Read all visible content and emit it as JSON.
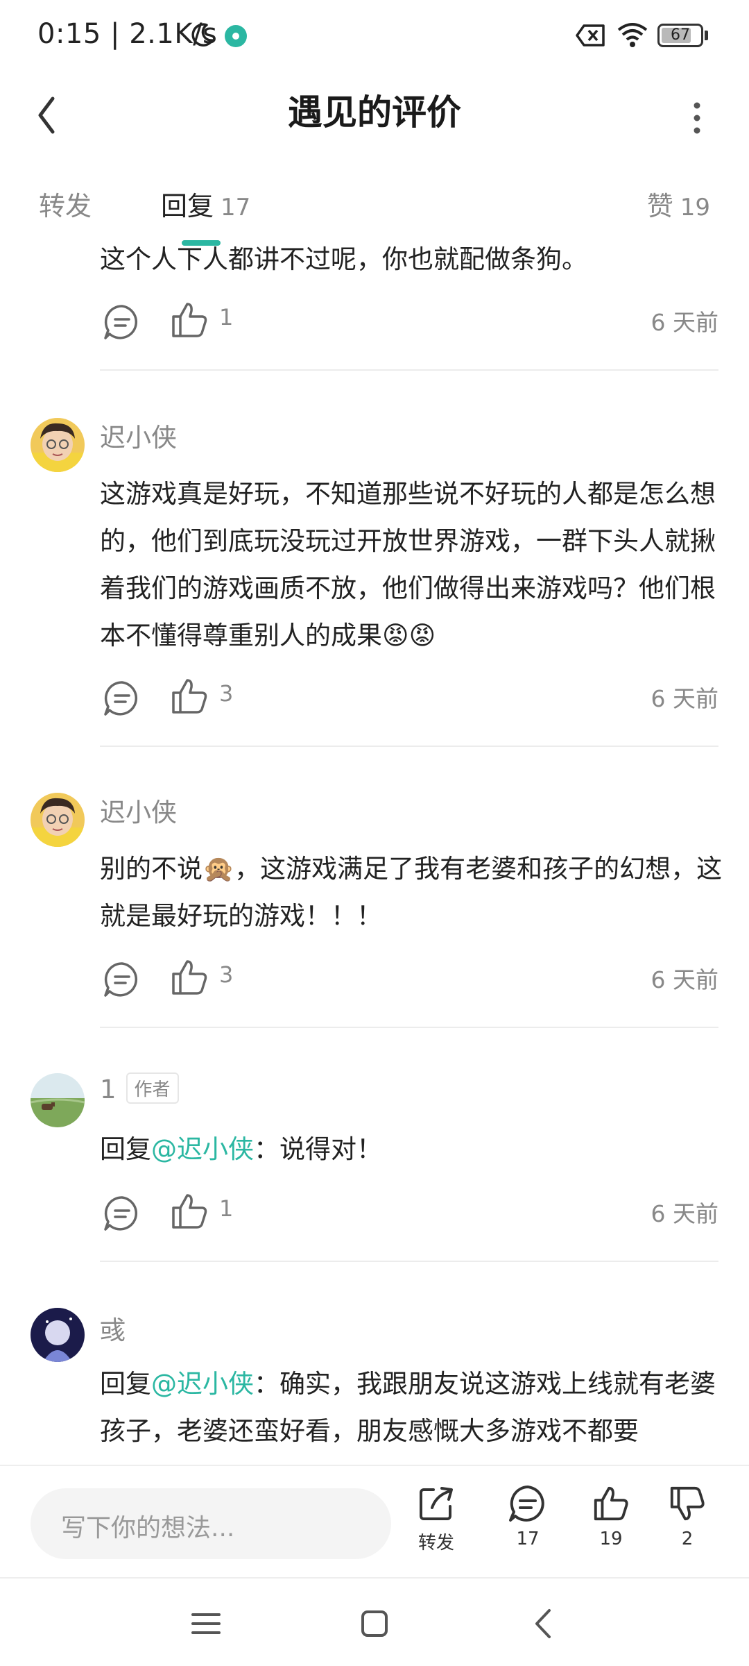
{
  "status_bar": {
    "time_speed": "0:15 | 2.1K/s",
    "battery": "67"
  },
  "header": {
    "title": "遇见的评价"
  },
  "tabs": {
    "repost_label": "转发",
    "reply_label": "回复",
    "reply_count": "17",
    "like_label": "赞",
    "like_count": "19"
  },
  "comments": [
    {
      "text": "这个人下人都讲不过呢，你也就配做条狗。",
      "likes": "1",
      "time": "6 天前"
    },
    {
      "user": "迟小侠",
      "text": "这游戏真是好玩，不知道那些说不好玩的人都是怎么想的，他们到底玩没玩过开放世界游戏，一群下头人就揪着我们的游戏画质不放，他们做得出来游戏吗？他们根本不懂得尊重别人的成果😡😡",
      "likes": "3",
      "time": "6 天前"
    },
    {
      "user": "迟小侠",
      "text": "别的不说🙊，这游戏满足了我有老婆和孩子的幻想，这就是最好玩的游戏！！！",
      "likes": "3",
      "time": "6 天前"
    },
    {
      "user": "1",
      "badge": "作者",
      "reply_prefix": "回复",
      "mention": "@迟小侠",
      "text": "：说得对！",
      "likes": "1",
      "time": "6 天前"
    },
    {
      "user": "彧",
      "reply_prefix": "回复",
      "mention": "@迟小侠",
      "text": "：确实，我跟朋友说这游戏上线就有老婆孩子，老婆还蛮好看，朋友感慨大多游戏不都要"
    }
  ],
  "bottom_bar": {
    "input_placeholder": "写下你的想法...",
    "repost_label": "转发",
    "comment_count": "17",
    "like_count": "19",
    "dislike_count": "2"
  },
  "colors": {
    "accent": "#2bb7a2",
    "text": "#222222",
    "muted": "#888888",
    "divider": "#ececec"
  },
  "icons": [
    "back-icon",
    "more-icon",
    "comment-icon",
    "like-icon",
    "share-icon",
    "dislike-icon",
    "menu-icon",
    "home-icon"
  ]
}
